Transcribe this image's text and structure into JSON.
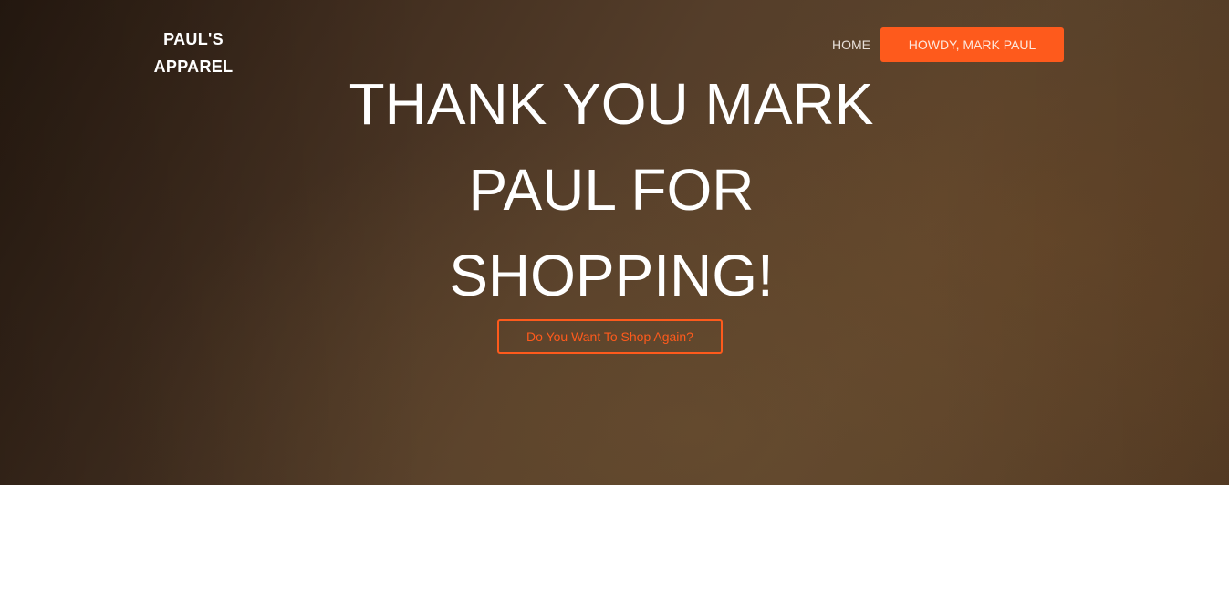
{
  "header": {
    "brand_line1": "PAUL'S",
    "brand_line2": "APPAREL",
    "nav_home": "HOME",
    "nav_user": "HOWDY, MARK PAUL"
  },
  "hero": {
    "headline": "THANK YOU MARK PAUL FOR SHOPPING!",
    "cta_label": "Do You Want To Shop Again?"
  },
  "colors": {
    "accent": "#fe5a1c",
    "hero_dark": "#2a1c12",
    "hero_light": "#5c442c"
  }
}
